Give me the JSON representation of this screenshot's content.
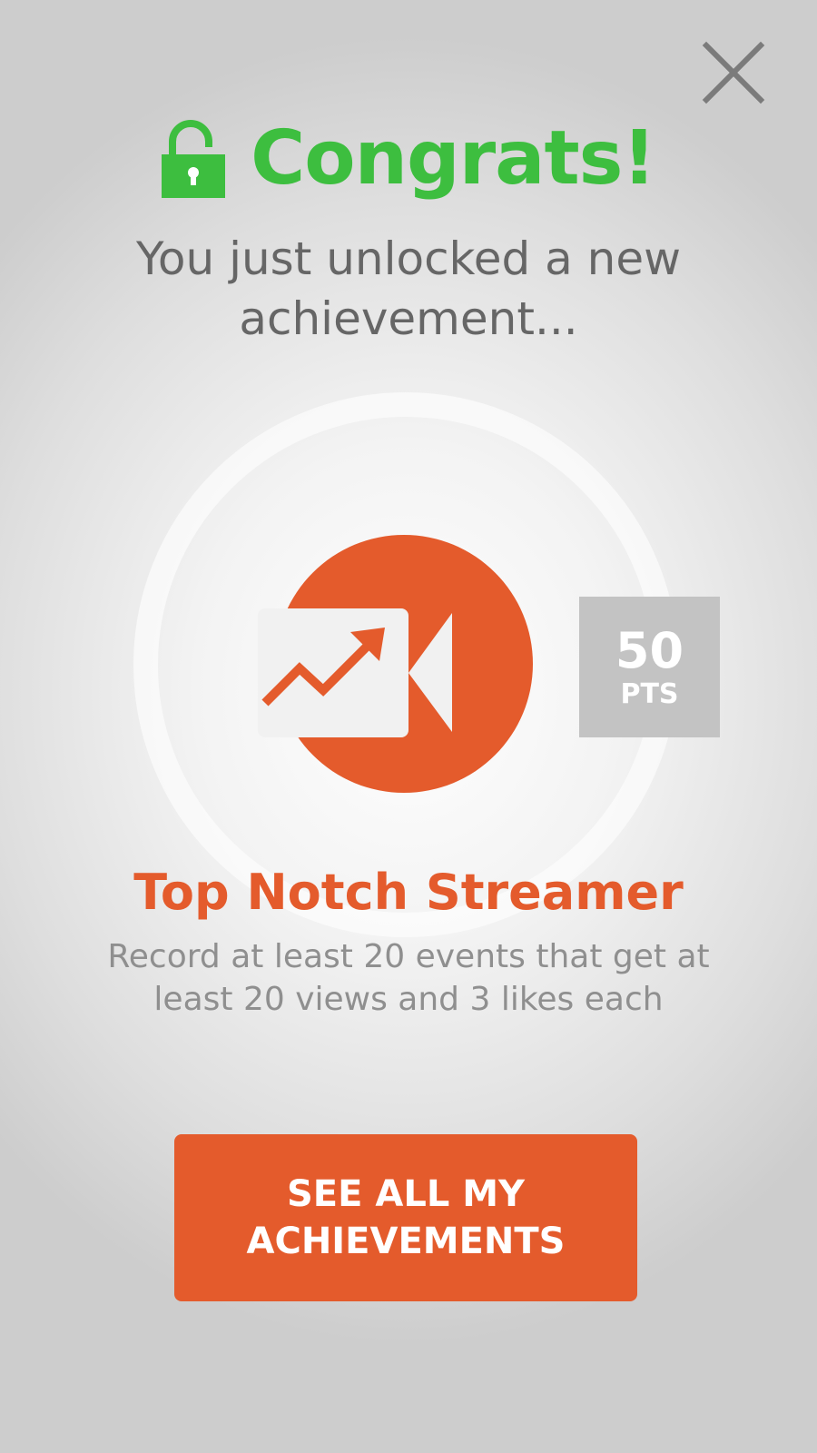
{
  "header": {
    "title": "Congrats!",
    "subtitle": "You just unlocked a new achievement..."
  },
  "achievement": {
    "name": "Top Notch Streamer",
    "description": "Record at least 20 events that get at least 20 views and 3 likes each",
    "points_value": "50",
    "points_unit": "PTS",
    "icon": "video-camera-trending-up-icon"
  },
  "actions": {
    "close_icon": "close-icon",
    "see_all_label": "SEE ALL MY ACHIEVEMENTS"
  },
  "colors": {
    "success_green": "#3dbe3f",
    "brand_orange": "#e45b2c",
    "text_gray": "#666666",
    "muted_gray": "#8f8f8f",
    "points_badge_gray": "#c3c3c3"
  }
}
